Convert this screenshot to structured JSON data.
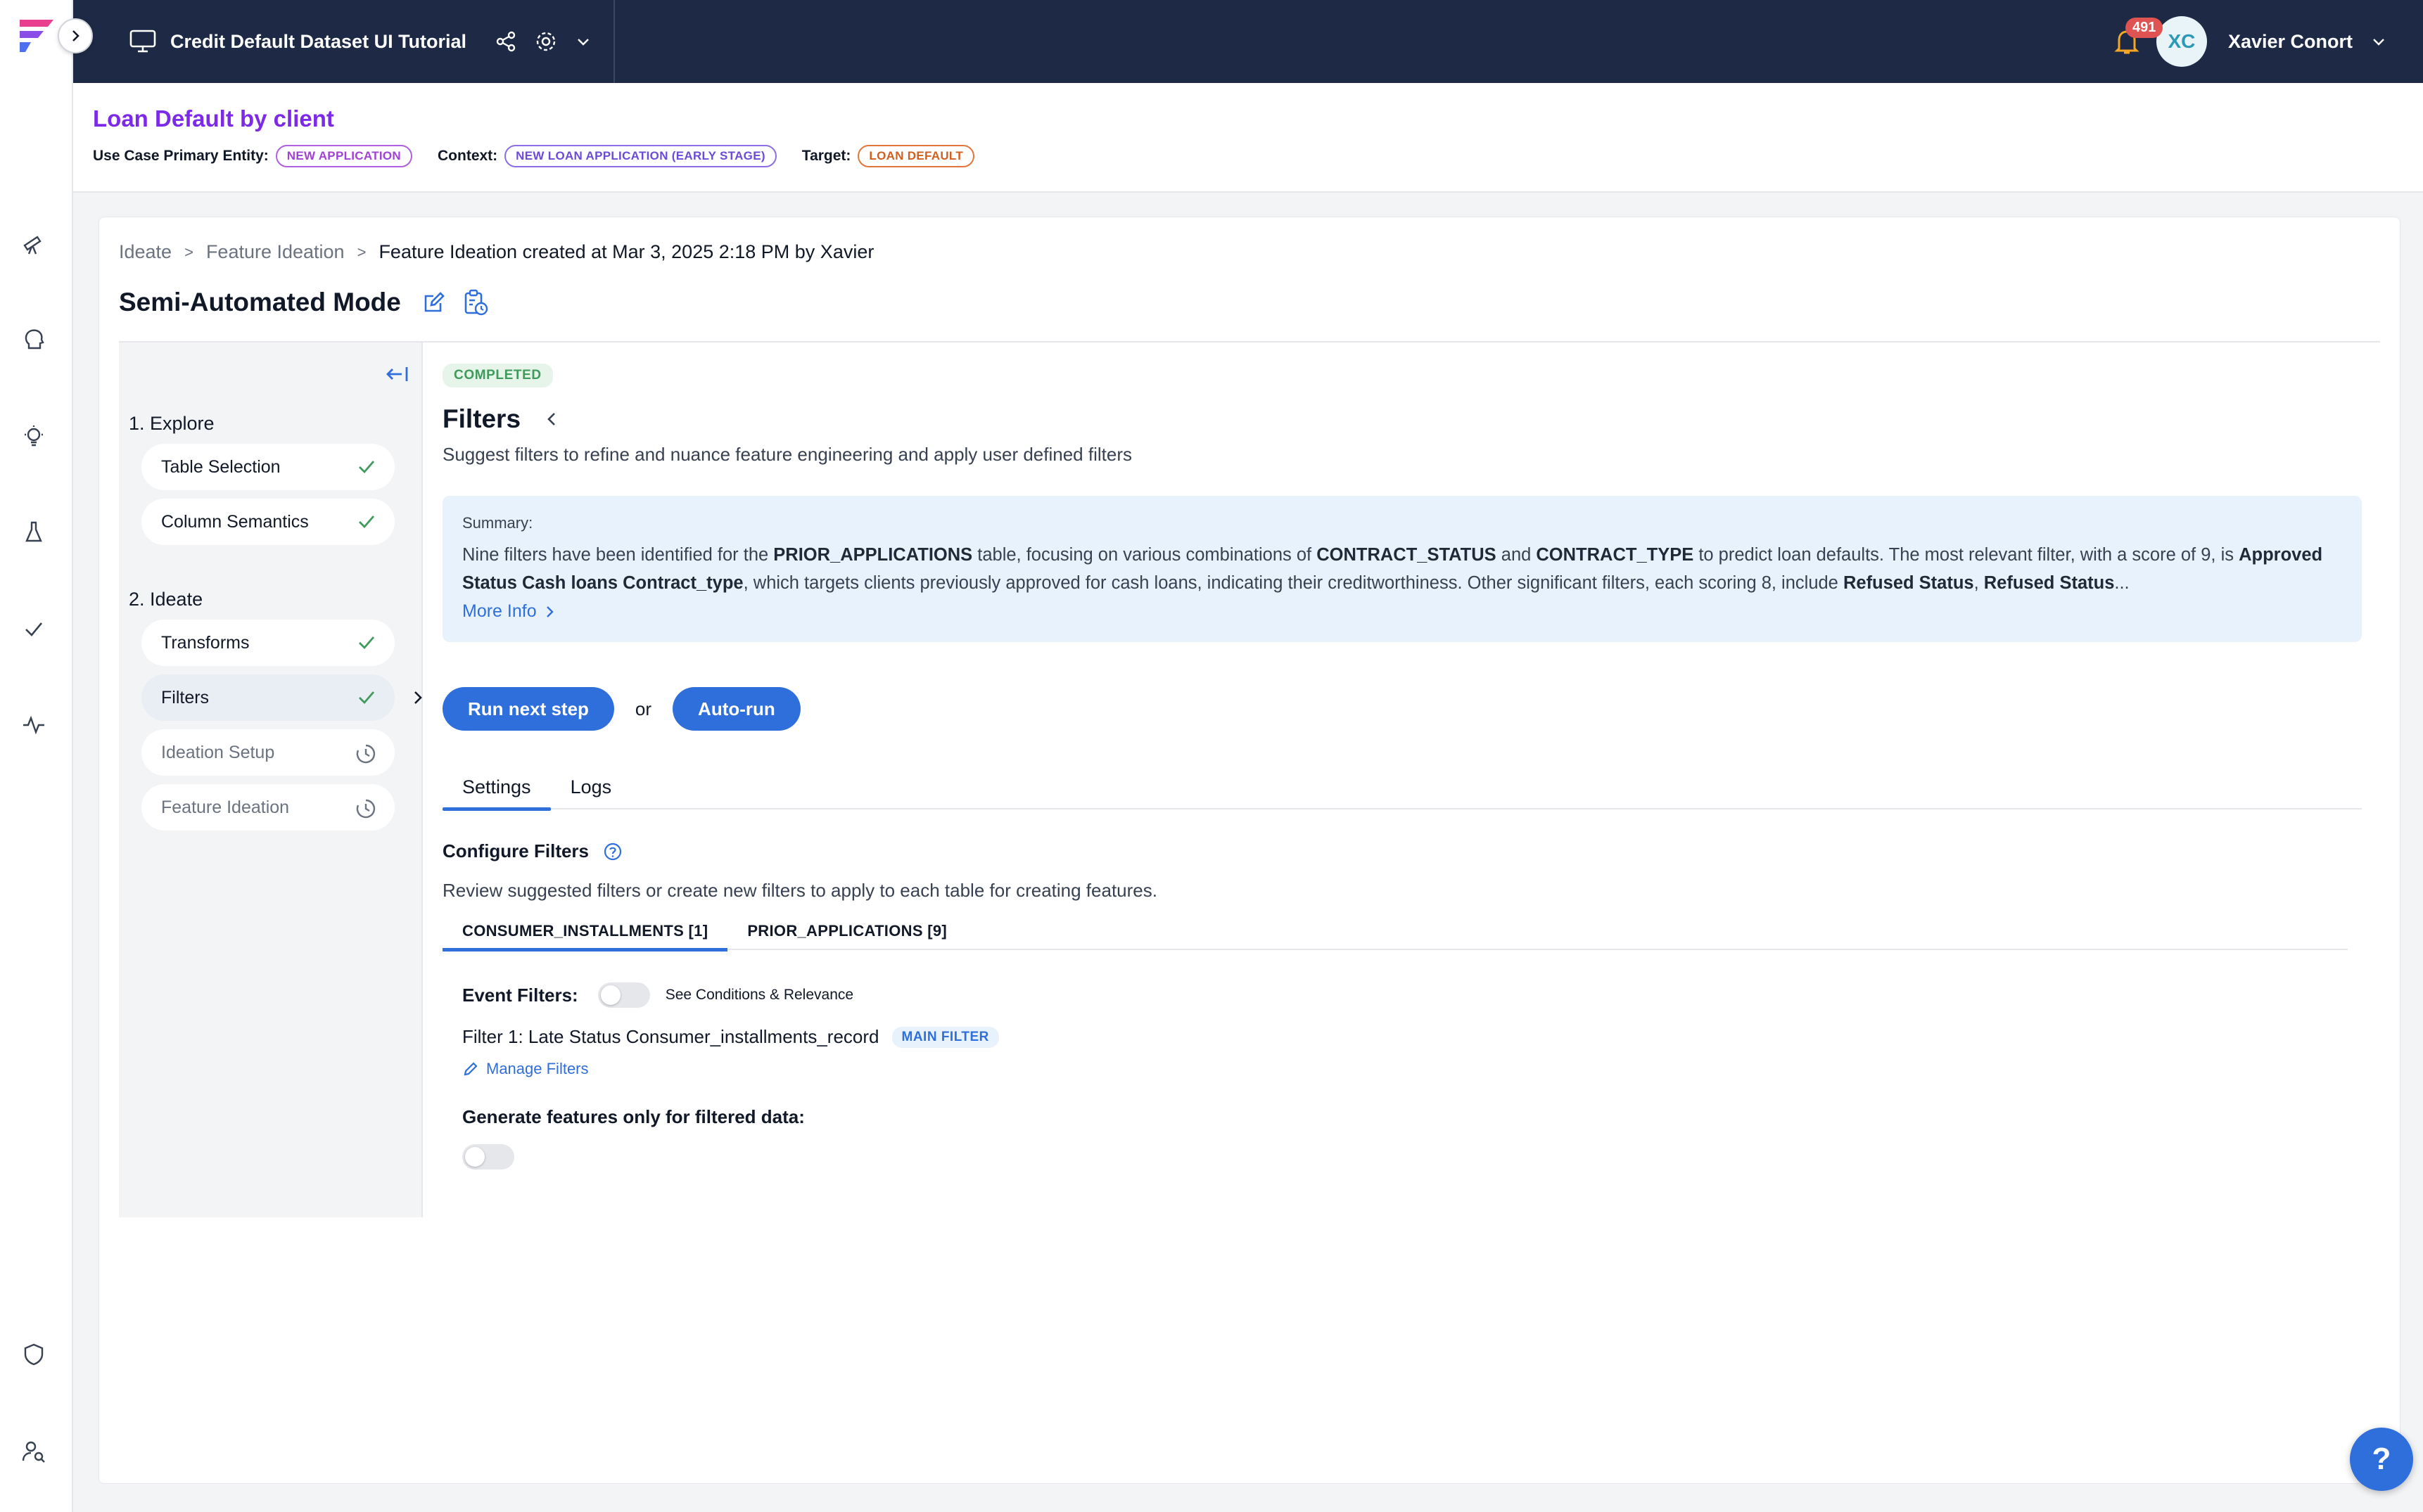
{
  "topbar": {
    "project_title": "Credit Default Dataset UI Tutorial",
    "notifications_count": "491",
    "avatar_initials": "XC",
    "user_name": "Xavier Conort"
  },
  "use_case": {
    "title": "Loan Default by client",
    "primary_entity_label": "Use Case Primary Entity:",
    "primary_entity": "NEW APPLICATION",
    "context_label": "Context:",
    "context": "NEW LOAN APPLICATION (EARLY STAGE)",
    "target_label": "Target:",
    "target": "LOAN DEFAULT"
  },
  "breadcrumb": {
    "items": [
      "Ideate",
      "Feature Ideation"
    ],
    "separator": ">",
    "current": "Feature Ideation created at Mar 3, 2025 2:18 PM by Xavier"
  },
  "mode_title": "Semi-Automated Mode",
  "steps": {
    "sections": [
      "1. Explore",
      "2. Ideate"
    ],
    "items": [
      {
        "label": "Table Selection",
        "status": "done"
      },
      {
        "label": "Column Semantics",
        "status": "done"
      },
      {
        "label": "Transforms",
        "status": "done"
      },
      {
        "label": "Filters",
        "status": "done"
      },
      {
        "label": "Ideation Setup",
        "status": "pending"
      },
      {
        "label": "Feature Ideation",
        "status": "pending"
      }
    ]
  },
  "content": {
    "status_badge": "COMPLETED",
    "title": "Filters",
    "subtitle": "Suggest filters to refine and nuance feature engineering and apply user defined filters",
    "summary_label": "Summary:",
    "summary_parts": [
      "Nine filters have been identified for the ",
      "PRIOR_APPLICATIONS",
      " table, focusing on various combinations of ",
      "CONTRACT_STATUS",
      " and ",
      "CONTRACT_TYPE",
      " to predict loan defaults. The most relevant filter, with a score of 9, is ",
      "Approved Status Cash loans Contract_type",
      ", which targets clients previously approved for cash loans, indicating their creditworthiness. Other significant filters, each scoring 8, include ",
      "Refused Status",
      ", ",
      "Refused Status",
      "..."
    ],
    "more_info": "More Info",
    "run_next_step": "Run next step",
    "or": "or",
    "auto_run": "Auto-run",
    "tabs": [
      "Settings",
      "Logs"
    ],
    "configure_title": "Configure Filters",
    "configure_sub": "Review suggested filters or create new filters to apply to each table for creating features.",
    "subtabs": [
      "CONSUMER_INSTALLMENTS [1]",
      "PRIOR_APPLICATIONS [9]"
    ],
    "event_filters_label": "Event Filters:",
    "see_conditions": "See Conditions & Relevance",
    "filter1": "Filter 1: Late Status Consumer_installments_record",
    "main_filter": "MAIN FILTER",
    "manage_filters": "Manage Filters",
    "generate_label": "Generate features only for filtered data:"
  },
  "help_label": "?",
  "colors": {
    "topbar": "#1e2a45",
    "accent": "#2f6fdb",
    "usecase_title": "#7c2ae8",
    "success": "#3f9a5b"
  }
}
